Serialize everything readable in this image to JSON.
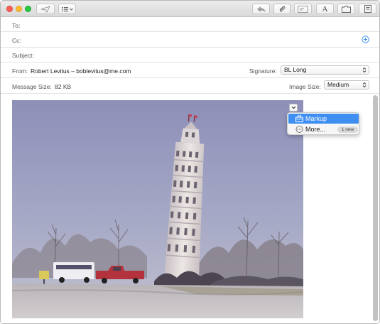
{
  "toolbar": {
    "buttons": [
      "send-icon",
      "format-icon",
      "reply-icon",
      "attach-icon",
      "header-fields-icon",
      "fonts-icon",
      "photo-browser-icon",
      "stationery-icon"
    ],
    "fonts_glyph": "A"
  },
  "header": {
    "to_label": "To:",
    "cc_label": "Cc:",
    "subject_label": "Subject:",
    "from_label": "From:",
    "from_value": "Robert Levitus – boblevitus@me.com",
    "signature_label": "Signature:",
    "signature_value": "BL Long",
    "message_size_label": "Message Size:",
    "message_size_value": "82 KB",
    "image_size_label": "Image Size:",
    "image_size_value": "Medium"
  },
  "menu": {
    "items": [
      {
        "label": "Markup",
        "icon": "toolbox-icon",
        "selected": true
      },
      {
        "label": "More...",
        "icon": "more-ellipsis-icon",
        "badge": "1 new"
      }
    ]
  },
  "colors": {
    "accent": "#3f8ff3",
    "add_button": "#3a8ef0"
  }
}
